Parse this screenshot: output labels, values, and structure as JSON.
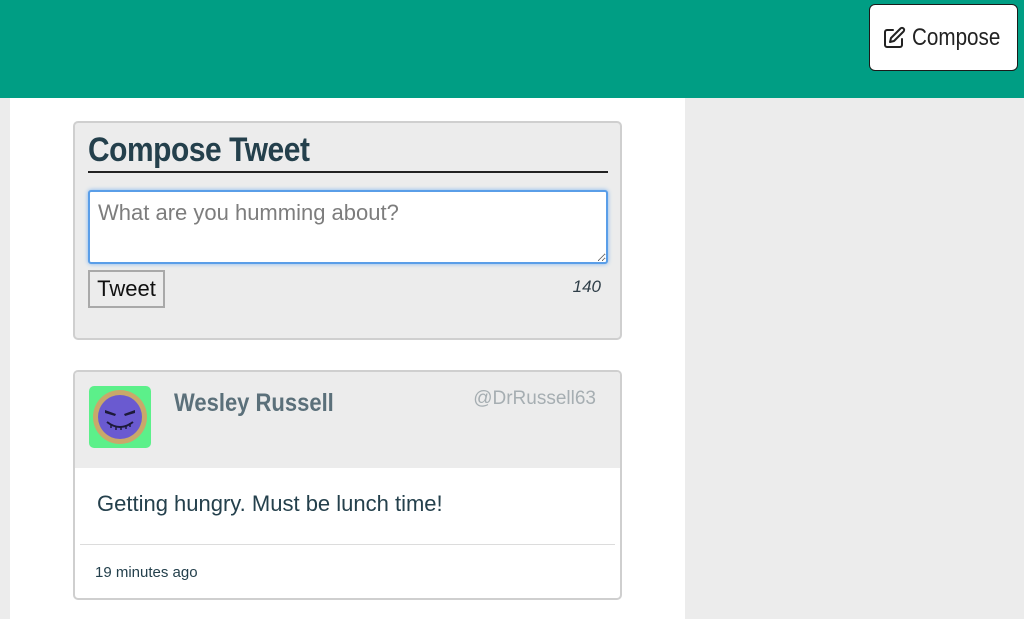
{
  "header": {
    "compose_button": {
      "label": "Compose",
      "icon": "pencil-square-icon"
    }
  },
  "compose": {
    "title": "Compose Tweet",
    "input": {
      "value": "",
      "placeholder": "What are you humming about?"
    },
    "submit_label": "Tweet",
    "char_counter": "140"
  },
  "tweets": [
    {
      "author_name": "Wesley Russell",
      "handle": "@DrRussell63",
      "avatar": "villain-face-avatar",
      "content": "Getting hungry. Must be lunch time!",
      "timestamp": "19 minutes ago"
    }
  ],
  "colors": {
    "header_bg": "#009e84",
    "page_bg": "#ececec",
    "title_text": "#24404c",
    "input_focus": "#5a9ee8"
  }
}
